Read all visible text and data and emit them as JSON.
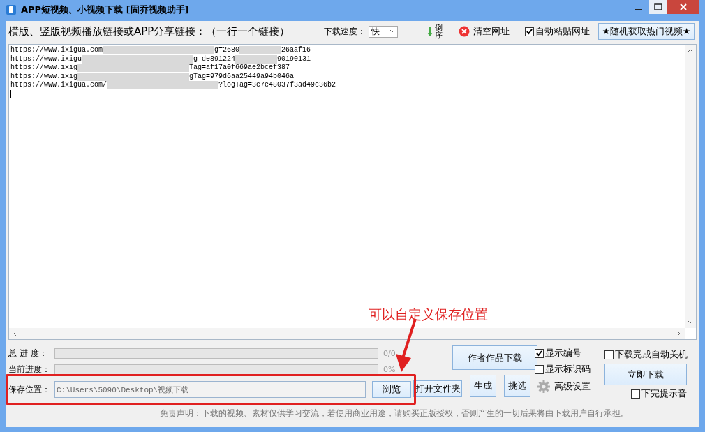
{
  "window": {
    "title": "APP短视频、小视频下载 [固乔视频助手]"
  },
  "toolbar": {
    "prompt": "横版、竖版视频播放链接或APP分享链接：（一行一个链接）",
    "speed_label": "下载速度：",
    "speed_value": "快",
    "reverse_label": "倒序",
    "clear_label": "清空网址",
    "auto_paste": {
      "label": "自动粘贴网址",
      "checked": true
    },
    "hot_button": "★随机获取热门视频★"
  },
  "links": [
    {
      "start": "https://www.ixigua.com",
      "end": [
        "g=2680",
        "26aaf16"
      ]
    },
    {
      "start": "https://www.ixigu",
      "end": [
        "g=de891224",
        "90190131"
      ]
    },
    {
      "start": "https://www.ixig",
      "end": [
        "Tag=af17a0f669ae2bcef387"
      ]
    },
    {
      "start": "https://www.ixig",
      "end": [
        "gTag=979d6aa25449a94b046a"
      ]
    },
    {
      "start": "https://www.ixigua.com/",
      "end": [
        "?logTag=3c7e48037f3ad49c36b2"
      ]
    }
  ],
  "progress": [
    {
      "label": "总 进 度：",
      "level": 0,
      "reading": "0/0"
    },
    {
      "label": "当前进度：",
      "level": 0,
      "reading": "0%"
    }
  ],
  "save": {
    "label": "保存位置：",
    "value": "C:\\Users\\5090\\Desktop\\视频下载",
    "browse": "浏览",
    "open_folder": "打开文件夹"
  },
  "actions": {
    "author_download": "作者作品下载",
    "generate": "生成",
    "pick": "挑选",
    "advanced": "高级设置",
    "download_now": "立即下载"
  },
  "options": [
    {
      "label": "显示编号",
      "checked": true
    },
    {
      "label": "显示标识码",
      "checked": false
    },
    {
      "label": "下载完成自动关机",
      "checked": false
    },
    {
      "label": "下完提示音",
      "checked": false
    }
  ],
  "disclaimer": "免责声明：下载的视频、素材仅供学习交流，若使用商业用途，请购买正版授权，否则产生的一切后果将由下载用户自行承担。",
  "annotation": {
    "text": "可以自定义保存位置"
  }
}
